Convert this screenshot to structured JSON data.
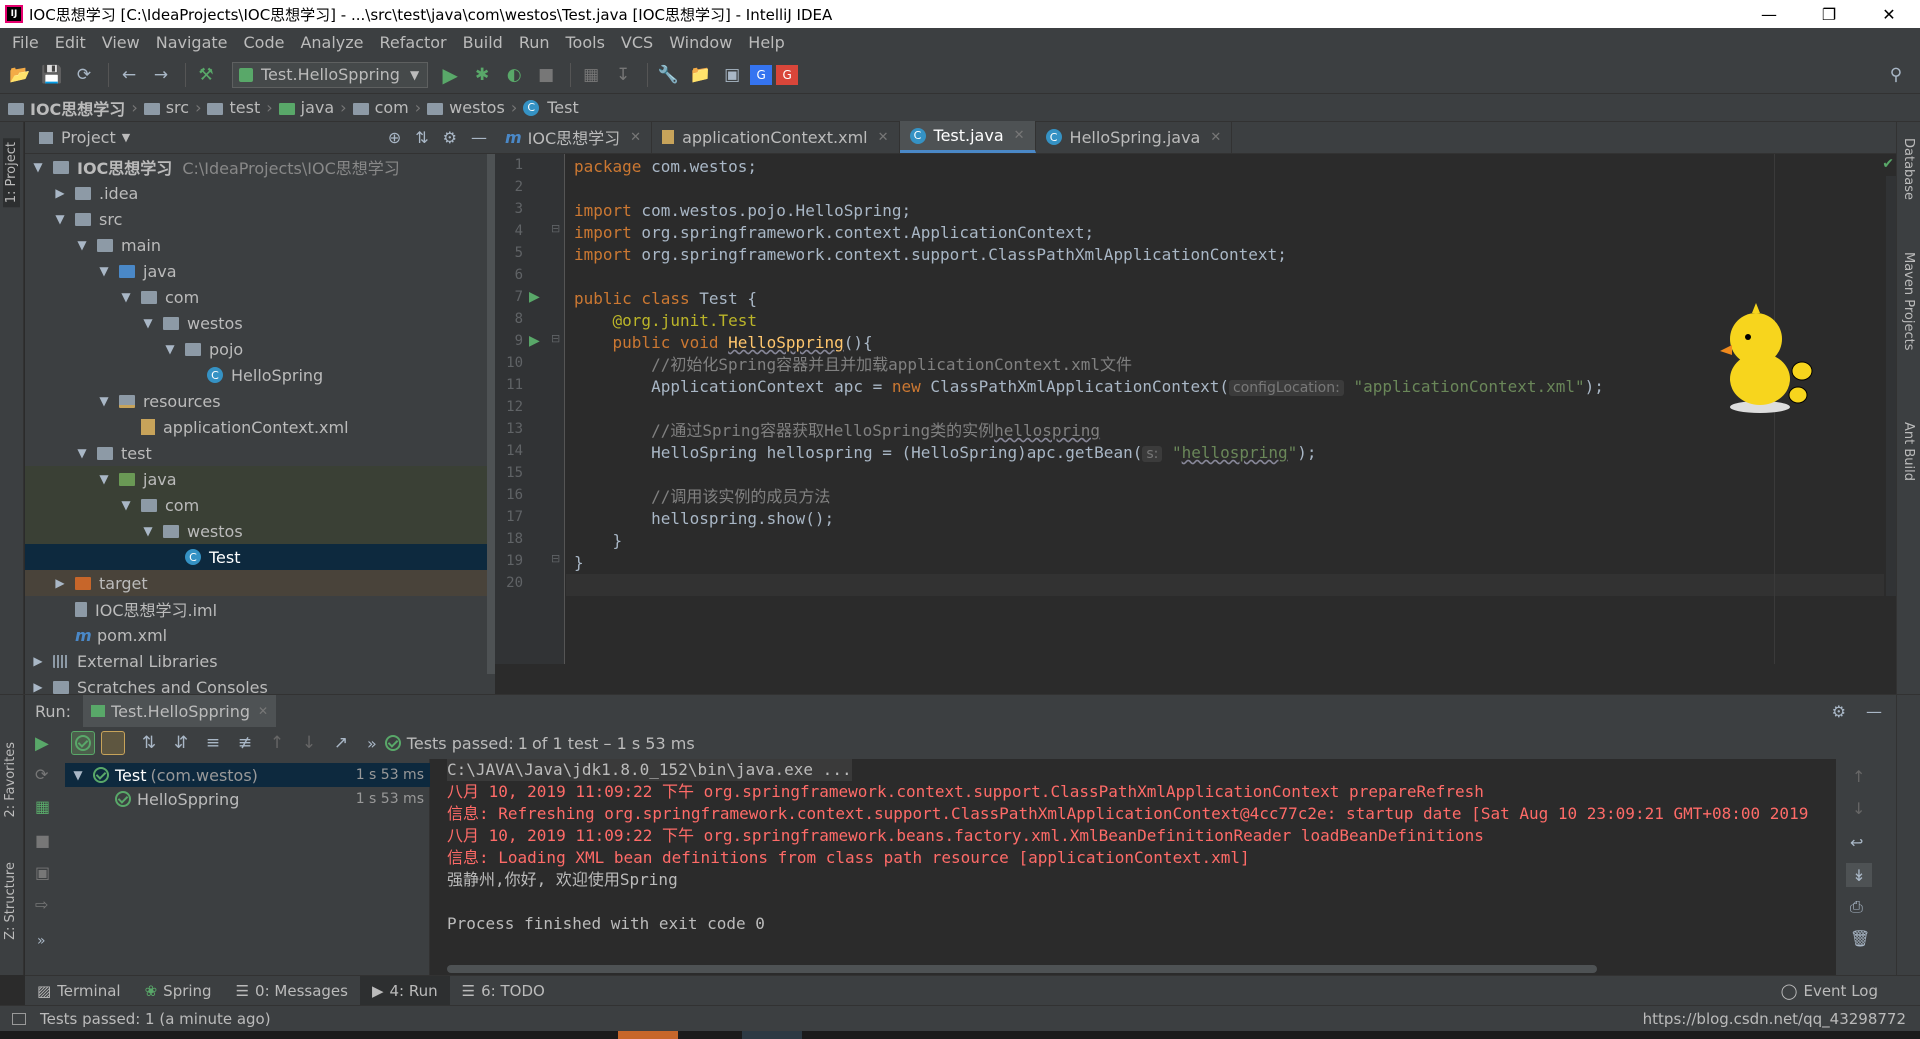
{
  "window": {
    "title": "IOC思想学习 [C:\\IdeaProjects\\IOC思想学习] - ...\\src\\test\\java\\com\\westos\\Test.java [IOC思想学习] - IntelliJ IDEA"
  },
  "menu": [
    "File",
    "Edit",
    "View",
    "Navigate",
    "Code",
    "Analyze",
    "Refactor",
    "Build",
    "Run",
    "Tools",
    "VCS",
    "Window",
    "Help"
  ],
  "toolbar": {
    "run_config": "Test.HelloSppring"
  },
  "breadcrumb": [
    "IOC思想学习",
    "src",
    "test",
    "java",
    "com",
    "westos",
    "Test"
  ],
  "left_tabs": {
    "project": "1: Project",
    "favorites": "2: Favorites",
    "structure": "Z: Structure"
  },
  "right_tabs": {
    "database": "Database",
    "maven": "Maven Projects",
    "ant": "Ant Build"
  },
  "project": {
    "header": "Project",
    "root_name": "IOC思想学习",
    "root_path": "C:\\IdeaProjects\\IOC思想学习",
    "items": [
      {
        "label": ".idea"
      },
      {
        "label": "src"
      },
      {
        "label": "main"
      },
      {
        "label": "java"
      },
      {
        "label": "com"
      },
      {
        "label": "westos"
      },
      {
        "label": "pojo"
      },
      {
        "label": "HelloSpring"
      },
      {
        "label": "resources"
      },
      {
        "label": "applicationContext.xml"
      },
      {
        "label": "test"
      },
      {
        "label": "java"
      },
      {
        "label": "com"
      },
      {
        "label": "westos"
      },
      {
        "label": "Test"
      },
      {
        "label": "target"
      },
      {
        "label": "IOC思想学习.iml"
      },
      {
        "label": "pom.xml"
      },
      {
        "label": "External Libraries"
      },
      {
        "label": "Scratches and Consoles"
      }
    ]
  },
  "editor": {
    "tabs": [
      {
        "label": "IOC思想学习"
      },
      {
        "label": "applicationContext.xml"
      },
      {
        "label": "Test.java"
      },
      {
        "label": "HelloSpring.java"
      }
    ],
    "line_numbers": [
      "1",
      "2",
      "3",
      "4",
      "5",
      "6",
      "7",
      "8",
      "9",
      "10",
      "11",
      "12",
      "13",
      "14",
      "15",
      "16",
      "17",
      "18",
      "19",
      "20"
    ],
    "code": {
      "l1_kw": "package",
      "l1_rest": " com.westos;",
      "l3_kw": "import",
      "l3_rest": " com.westos.pojo.HelloSpring;",
      "l4_kw": "import",
      "l4_rest": " org.springframework.context.ApplicationContext;",
      "l5_kw": "import",
      "l5_rest": " org.springframework.context.support.ClassPathXmlApplicationContext;",
      "l7_kw": "public class",
      "l7_rest": " Test {",
      "l8": "    @org.junit.Test",
      "l9_kw": "    public void ",
      "l9_fn": "HelloSppring",
      "l9_rest": "(){",
      "l10": "        //初始化Spring容器并且并加载applicationContext.xml文件",
      "l11_a": "        ApplicationContext apc = ",
      "l11_kw": "new",
      "l11_b": " ClassPathXmlApplicationContext(",
      "l11_hint": "configLocation:",
      "l11_str": " \"applicationContext.xml\"",
      "l11_c": ");",
      "l13_a": "        //通过Spring容器获取HelloSpring类的实例",
      "l13_b": "hellospring",
      "l14_a": "        HelloSpring hellospring = (HelloSpring)apc.getBean(",
      "l14_hint": "s:",
      "l14_str1": " \"",
      "l14_str2": "hellospring",
      "l14_str3": "\"",
      "l14_c": ");",
      "l16": "        //调用该实例的成员方法",
      "l17": "        hellospring.show();",
      "l18": "    }",
      "l19": "}"
    }
  },
  "run": {
    "label": "Run:",
    "tab": "Test.HelloSppring",
    "status_prefix": "Tests passed:",
    "status_count": "1",
    "status_suffix": "of 1 test – 1 s 53 ms",
    "tests": [
      {
        "name": "Test",
        "pkg": "(com.westos)",
        "time": "1 s 53 ms"
      },
      {
        "name": "HelloSppring",
        "time": "1 s 53 ms"
      }
    ],
    "console": [
      "C:\\JAVA\\Java\\jdk1.8.0_152\\bin\\java.exe ...",
      "八月 10, 2019 11:09:22 下午 org.springframework.context.support.ClassPathXmlApplicationContext prepareRefresh",
      "信息: Refreshing org.springframework.context.support.ClassPathXmlApplicationContext@4cc77c2e: startup date [Sat Aug 10 23:09:21 GMT+08:00 2019",
      "八月 10, 2019 11:09:22 下午 org.springframework.beans.factory.xml.XmlBeanDefinitionReader loadBeanDefinitions",
      "信息: Loading XML bean definitions from class path resource [applicationContext.xml]",
      "强静州,你好, 欢迎使用Spring",
      "Process finished with exit code 0"
    ]
  },
  "bottom_tabs": [
    {
      "label": "Terminal"
    },
    {
      "label": "Spring"
    },
    {
      "label": "0: Messages"
    },
    {
      "label": "4: Run"
    },
    {
      "label": "6: TODO"
    }
  ],
  "event_log": "Event Log",
  "status": {
    "message": "Tests passed: 1 (a minute ago)",
    "right": "https://blog.csdn.net/qq_43298772"
  },
  "colors": {
    "accent": "#4a88c7",
    "pass": "#59a869",
    "error_text": "#ff6b68"
  }
}
